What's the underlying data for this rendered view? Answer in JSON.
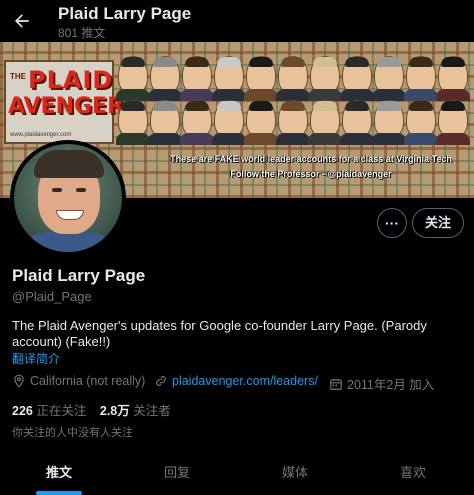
{
  "header": {
    "back_icon": "arrow-left-icon",
    "title": "Plaid Larry Page",
    "post_count": "801 推文"
  },
  "banner": {
    "logo_the": "THE",
    "logo_line1": "PLAID",
    "logo_line2": "AVENGER",
    "logo_url": "www.plaidavenger.com",
    "caption_line1": "These are FAKE world leader accounts for a class at Virginia Tech",
    "caption_line2": "Follow the Professor - @plaidavenger"
  },
  "profile": {
    "more_icon": "more-dots-icon",
    "follow_label": "关注",
    "name": "Plaid Larry Page",
    "handle": "@Plaid_Page",
    "bio": "The Plaid Avenger's updates for Google co-founder Larry Page. (Parody account) (Fake!!)",
    "translate_label": "翻译简介",
    "location_icon": "location-pin-icon",
    "location": "California (not really)",
    "link_icon": "link-icon",
    "link_text": "plaidavenger.com/leaders/",
    "calendar_icon": "calendar-icon",
    "joined": "2011年2月 加入"
  },
  "stats": {
    "following_count": "226",
    "following_label": "正在关注",
    "followers_count": "2.8万",
    "followers_label": "关注者"
  },
  "followers_note": "你关注的人中没有人关注",
  "tabs": [
    {
      "label": "推文"
    },
    {
      "label": "回复"
    },
    {
      "label": "媒体"
    },
    {
      "label": "喜欢"
    }
  ],
  "colors": {
    "accent": "#1d9bf0",
    "background": "#000000",
    "text_primary": "#e7e9ea",
    "text_secondary": "#71767b"
  }
}
